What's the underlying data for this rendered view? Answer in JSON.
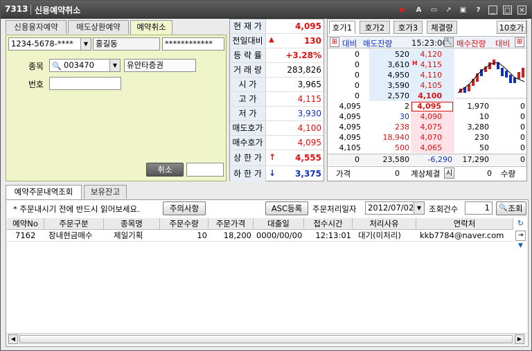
{
  "titlebar": {
    "screen_id": "7313",
    "title": "신용예약취소",
    "icons": [
      "record-icon",
      "font-icon",
      "memo-icon",
      "link-icon",
      "window-icon",
      "help-icon",
      "minimize-icon",
      "maximize-icon",
      "close-icon"
    ]
  },
  "left_tabs": [
    "신용융자예약",
    "매도상환예약",
    "예약취소"
  ],
  "account": {
    "number": "1234-5678-****",
    "name": "홍길동",
    "password": "************"
  },
  "form": {
    "stock_label": "종목",
    "stock_code": "003470",
    "stock_name": "유안타증권",
    "number_label": "번호",
    "number_value": "",
    "cancel_label": "취소",
    "cancel_value": ""
  },
  "quote": [
    {
      "label": "현 재 가",
      "value": "4,095",
      "color": "#e01010",
      "bold": true
    },
    {
      "label": "전일대비",
      "value": "130",
      "color": "#e01010",
      "bold": true,
      "arrow": "▲"
    },
    {
      "label": "등 락 률",
      "value": "+3.28%",
      "color": "#e01010",
      "bold": true
    },
    {
      "label": "거 래 량",
      "value": "283,826",
      "color": "#000"
    },
    {
      "label": "시  가",
      "value": "3,965",
      "color": "#000"
    },
    {
      "label": "고  가",
      "value": "4,115",
      "color": "#e01010"
    },
    {
      "label": "저  가",
      "value": "3,930",
      "color": "#1030c0"
    },
    {
      "label": "매도호가",
      "value": "4,100",
      "color": "#e01010"
    },
    {
      "label": "매수호가",
      "value": "4,095",
      "color": "#e01010"
    },
    {
      "label": "상 한 가",
      "value": "4,555",
      "color": "#e01010",
      "bold": true,
      "arrow": "↑"
    },
    {
      "label": "하 한 가",
      "value": "3,375",
      "color": "#1030c0",
      "bold": true,
      "arrow": "↓"
    }
  ],
  "orderbook": {
    "tabs": [
      "호가1",
      "호가2",
      "호가3",
      "체결량"
    ],
    "tab_10": "10호가",
    "header": {
      "change": "대비",
      "sell_qty": "매도잔량",
      "time": "15:23:00",
      "buy_qty": "매수잔량",
      "change2": "대비"
    },
    "asks": [
      {
        "chg": "0",
        "qty": "520",
        "price": "4,120",
        "mark": ""
      },
      {
        "chg": "0",
        "qty": "3,610",
        "price": "4,115",
        "mark": "H"
      },
      {
        "chg": "0",
        "qty": "4,950",
        "price": "4,110",
        "mark": ""
      },
      {
        "chg": "0",
        "qty": "3,590",
        "price": "4,105",
        "mark": ""
      },
      {
        "chg": "0",
        "qty": "2,570",
        "price": "4,100",
        "mark": ""
      }
    ],
    "ticks": [
      {
        "price": "4,095",
        "vol": "2",
        "color": "#000"
      },
      {
        "price": "4,095",
        "vol": "30",
        "color": "#1030c0"
      },
      {
        "price": "4,095",
        "vol": "238",
        "color": "#e01010"
      },
      {
        "price": "4,095",
        "vol": "18,940",
        "color": "#e01010"
      },
      {
        "price": "4,105",
        "vol": "500",
        "color": "#e01010"
      }
    ],
    "bids": [
      {
        "price": "4,095",
        "qty": "1,970",
        "chg": "0"
      },
      {
        "price": "4,090",
        "qty": "10",
        "chg": "0"
      },
      {
        "price": "4,075",
        "qty": "3,280",
        "chg": "0"
      },
      {
        "price": "4,070",
        "qty": "230",
        "chg": "0"
      },
      {
        "price": "4,065",
        "qty": "50",
        "chg": "0"
      }
    ],
    "totals": {
      "ask_chg": "0",
      "ask_total": "23,580",
      "diff": "-6,290",
      "bid_total": "17,290",
      "bid_chg": "0"
    },
    "footer": {
      "price_label": "가격",
      "price_value": "0",
      "sim_label": "계상체결",
      "sim_btn": "시",
      "qty_value": "0",
      "qty_label": "수량"
    }
  },
  "bottom_tabs": [
    "예약주문내역조회",
    "보유잔고"
  ],
  "notice": "* 주문내시기 전에 반드시 읽어보세요.",
  "buttons": {
    "caution": "주의사항",
    "asc": "ASC등록",
    "search": "조회"
  },
  "filters": {
    "date_label": "주문처리일자",
    "date": "2012/07/02",
    "count_label": "조회건수",
    "count": "1"
  },
  "table": {
    "headers": [
      "예약No",
      "주문구분",
      "종목명",
      "주문수량",
      "주문가격",
      "대출일",
      "접수시간",
      "처리사유",
      "연락처"
    ],
    "rows": [
      [
        "7162",
        "장내현금매수",
        "제일기획",
        "10",
        "18,200",
        "0000/00/00",
        "12:13:01",
        "대기(미처리)",
        "kkb7784@naver.com"
      ]
    ]
  },
  "chart_data": {
    "type": "candlestick",
    "title": "",
    "series": []
  }
}
